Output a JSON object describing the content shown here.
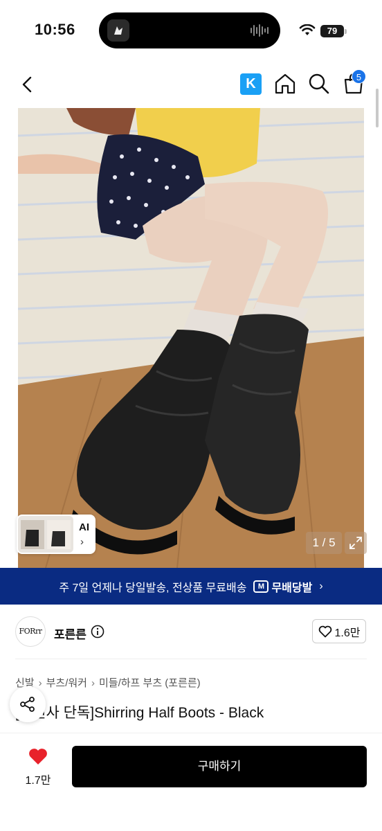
{
  "status_bar": {
    "time": "10:56",
    "battery": "79"
  },
  "nav": {
    "k_label": "K",
    "cart_count": "5"
  },
  "hero": {
    "ai_label": "AI",
    "pager": "1 / 5"
  },
  "banner": {
    "text": "주 7일 언제나 당일발송, 전상품 무료배송",
    "logo_mark": "M",
    "logo_text": "무배당발",
    "chevron": "›"
  },
  "brand": {
    "logo_text": "FORrr",
    "name": "포른른",
    "like_count": "1.6만"
  },
  "breadcrumb": [
    "신발",
    "부츠/워커",
    "미들/하프 부츠 (포른른)"
  ],
  "product": {
    "title": "[무신사 단독]Shirring Half Boots - Black"
  },
  "bottom": {
    "likes": "1.7만",
    "buy_label": "구매하기"
  },
  "colors": {
    "banner": "#0a2b82",
    "k_icon": "#1aa0f5",
    "badge": "#1a73e8",
    "heart": "#e8222b"
  }
}
